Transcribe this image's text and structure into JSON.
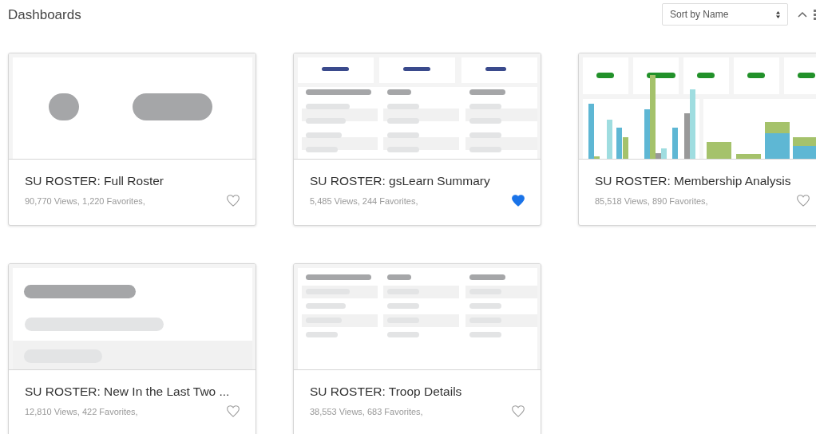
{
  "header": {
    "title": "Dashboards",
    "sort": {
      "value": "Sort by Name"
    }
  },
  "dashboards": [
    {
      "title": "SU ROSTER: Full Roster",
      "stats": "90,770 Views, 1,220 Favorites,",
      "favorite": false,
      "preview": {
        "kind": "blank"
      }
    },
    {
      "title": "SU ROSTER: gsLearn Summary",
      "stats": "5,485 Views, 244 Favorites,",
      "favorite": true,
      "preview": {
        "kind": "table-kpi"
      }
    },
    {
      "title": "SU ROSTER: Membership Analysis",
      "stats": "85,518 Views, 890 Favorites,",
      "favorite": false,
      "preview": {
        "kind": "charts"
      }
    },
    {
      "title": "SU ROSTER: New In the Last Two ...",
      "stats": "12,810 Views, 422 Favorites,",
      "favorite": false,
      "preview": {
        "kind": "list"
      }
    },
    {
      "title": "SU ROSTER: Troop Details",
      "stats": "38,553 Views, 683 Favorites,",
      "favorite": false,
      "preview": {
        "kind": "table"
      }
    }
  ]
}
